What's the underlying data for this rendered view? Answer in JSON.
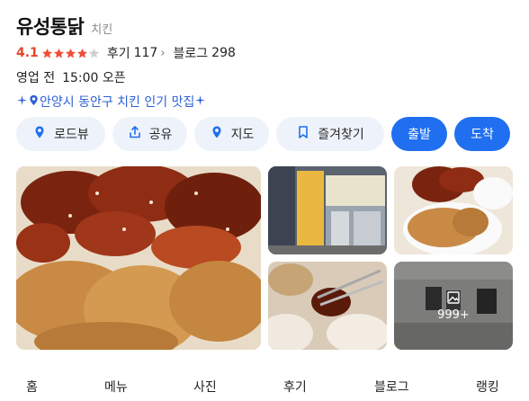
{
  "place": {
    "name": "유성통닭",
    "category": "치킨",
    "rating": "4.1",
    "stars_filled": 4,
    "stars_total": 5,
    "review_label": "후기",
    "review_count": "117",
    "blog_label": "블로그",
    "blog_count": "298",
    "status": "영업 전",
    "open_time": "15:00 오픈",
    "tagline": "안양시 동안구 치킨 인기 맛집"
  },
  "actions": [
    {
      "label": "로드뷰",
      "icon": "roadview-pin-icon"
    },
    {
      "label": "공유",
      "icon": "share-icon"
    },
    {
      "label": "지도",
      "icon": "map-pin-icon"
    },
    {
      "label": "즐겨찾기",
      "icon": "bookmark-icon"
    },
    {
      "label": "출발",
      "icon": ""
    },
    {
      "label": "도착",
      "icon": ""
    }
  ],
  "photos": {
    "more_count": "999+"
  },
  "tabs": [
    "홈",
    "메뉴",
    "사진",
    "후기",
    "블로그",
    "랭킹"
  ],
  "colors": {
    "accent_blue": "#1f6ff0",
    "rating_red": "#e8442b",
    "star_red": "#ef4f37",
    "pill_bg": "#eef3fb",
    "tag_blue": "#2f61d6"
  }
}
